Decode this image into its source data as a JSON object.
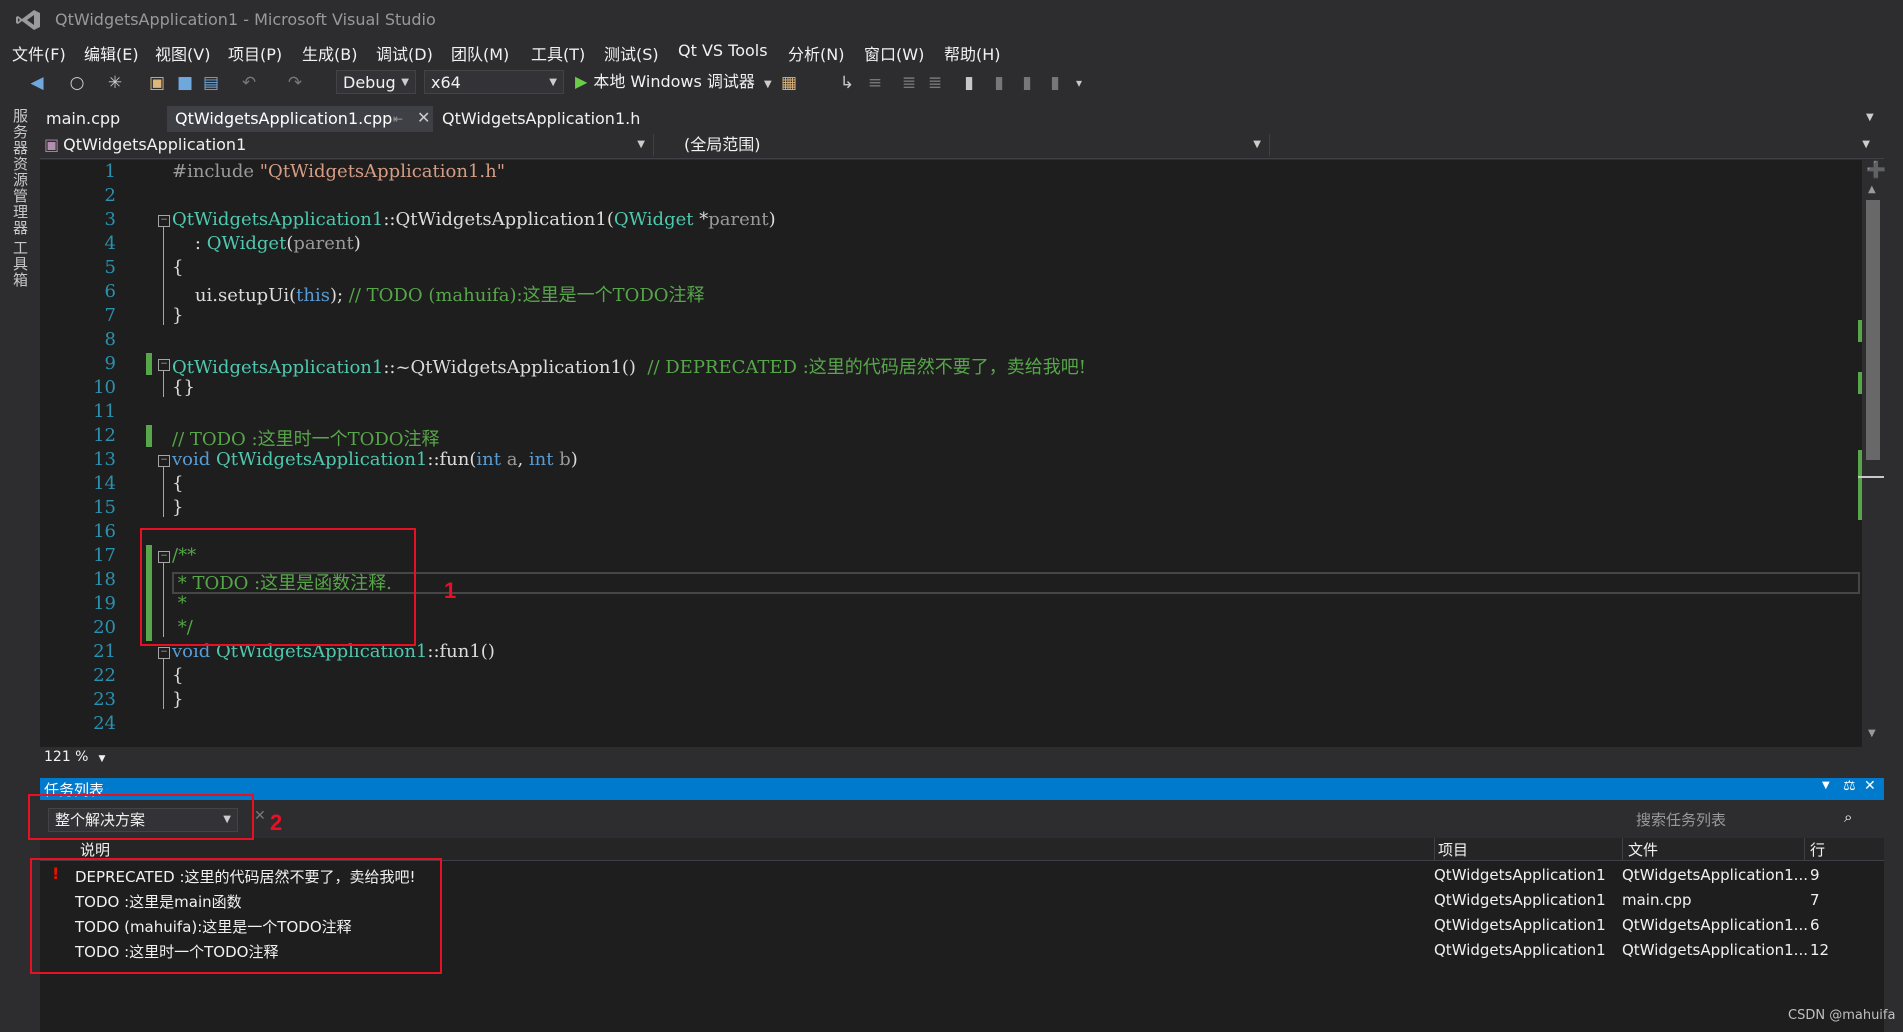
{
  "window": {
    "title": "QtWidgetsApplication1 - Microsoft Visual Studio"
  },
  "menu": [
    "文件(F)",
    "编辑(E)",
    "视图(V)",
    "项目(P)",
    "生成(B)",
    "调试(D)",
    "团队(M)",
    "工具(T)",
    "测试(S)",
    "Qt VS Tools",
    "分析(N)",
    "窗口(W)",
    "帮助(H)"
  ],
  "toolbar": {
    "config": "Debug",
    "platform": "x64",
    "run_label": "本地 Windows 调试器"
  },
  "left_rail": [
    "服务器资源管理器",
    "工具箱"
  ],
  "tabs": [
    {
      "label": "main.cpp"
    },
    {
      "label": "QtWidgetsApplication1.cpp"
    },
    {
      "label": "QtWidgetsApplication1.h"
    }
  ],
  "navbar": {
    "project": "QtWidgetsApplication1",
    "scope": "(全局范围)"
  },
  "editor": {
    "zoom": "121 %",
    "line_numbers": [
      "1",
      "2",
      "3",
      "4",
      "5",
      "6",
      "7",
      "8",
      "9",
      "10",
      "11",
      "12",
      "13",
      "14",
      "15",
      "16",
      "17",
      "18",
      "19",
      "20",
      "21",
      "22",
      "23",
      "24"
    ]
  },
  "task_list": {
    "title": "任务列表",
    "scope": "整个解决方案",
    "search_placeholder": "搜索任务列表",
    "columns": {
      "desc": "说明",
      "project": "项目",
      "file": "文件",
      "line": "行"
    },
    "rows": [
      {
        "desc": "DEPRECATED :这里的代码居然不要了，卖给我吧!",
        "project": "QtWidgetsApplication1",
        "file": "QtWidgetsApplication1...",
        "line": "9",
        "flag": "!"
      },
      {
        "desc": "TODO :这里是main函数",
        "project": "QtWidgetsApplication1",
        "file": "main.cpp",
        "line": "7",
        "flag": ""
      },
      {
        "desc": "TODO (mahuifa):这里是一个TODO注释",
        "project": "QtWidgetsApplication1",
        "file": "QtWidgetsApplication1...",
        "line": "6",
        "flag": ""
      },
      {
        "desc": "TODO :这里时一个TODO注释",
        "project": "QtWidgetsApplication1",
        "file": "QtWidgetsApplication1...",
        "line": "12",
        "flag": ""
      }
    ]
  },
  "annotations": {
    "one": "1",
    "two": "2"
  },
  "watermark": "CSDN @mahuifa",
  "colors": {
    "accent": "#007acc",
    "annotation": "#e81123",
    "comment": "#57a64a",
    "keyword": "#569cd6",
    "type": "#4ec9b0"
  }
}
